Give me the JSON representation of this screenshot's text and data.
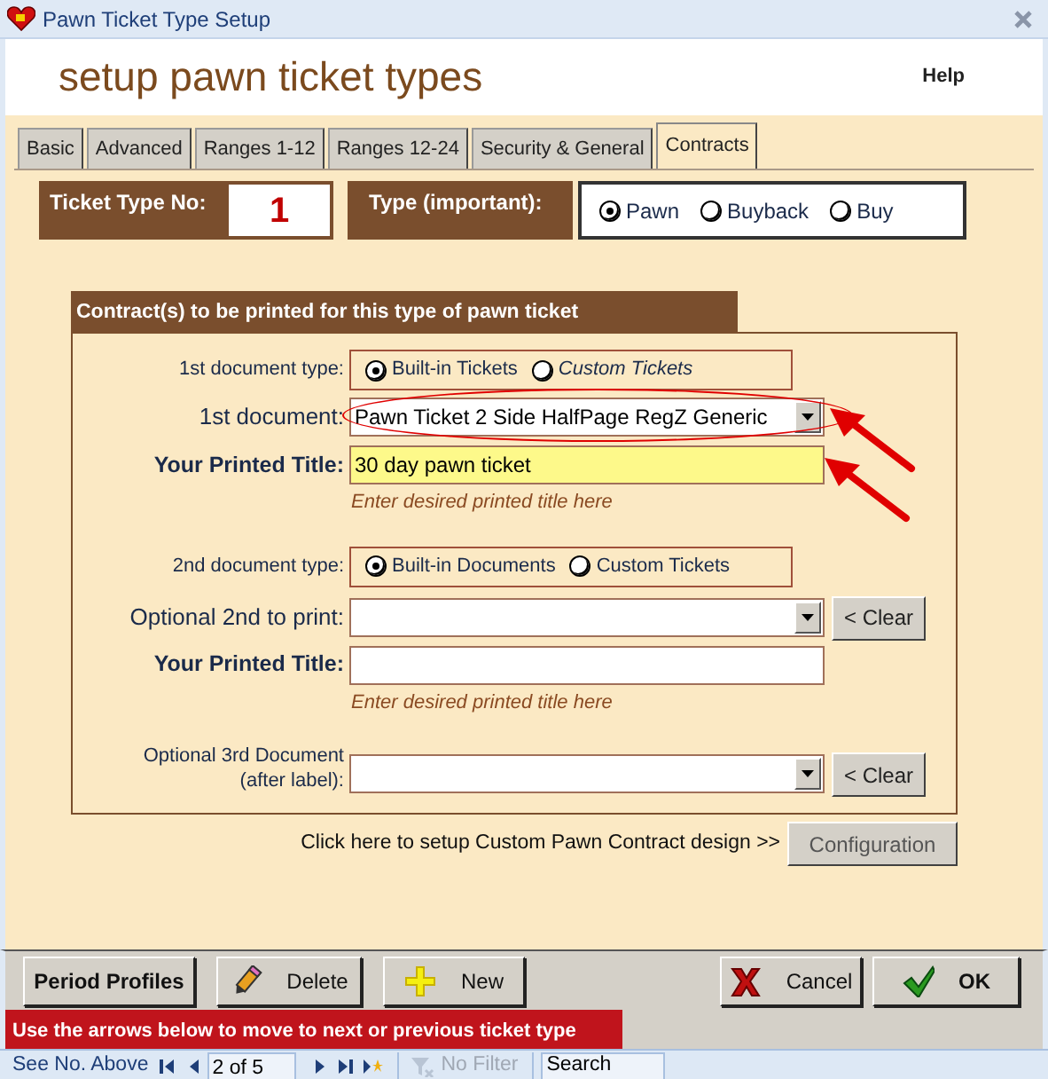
{
  "window": {
    "title": "Pawn Ticket Type Setup"
  },
  "header": {
    "title": "setup pawn ticket types",
    "help_link": "Help"
  },
  "tabs": [
    {
      "label": "Basic",
      "selected": false
    },
    {
      "label": "Advanced",
      "selected": false
    },
    {
      "label": "Ranges 1-12",
      "selected": false
    },
    {
      "label": "Ranges 12-24",
      "selected": false
    },
    {
      "label": "Security & General",
      "selected": false
    },
    {
      "label": "Contracts",
      "selected": true
    }
  ],
  "ticket_type": {
    "label": "Ticket Type No:",
    "value": "1"
  },
  "type": {
    "label": "Type (important):",
    "options": [
      {
        "label": "Pawn",
        "selected": true
      },
      {
        "label": "Buyback",
        "selected": false
      },
      {
        "label": "Buy",
        "selected": false
      }
    ]
  },
  "contracts": {
    "title": "Contract(s) to be printed for this type of pawn ticket",
    "first": {
      "type_label": "1st document type:",
      "type_options": [
        {
          "label": "Built-in Tickets",
          "selected": true,
          "italic": false
        },
        {
          "label": "Custom Tickets",
          "selected": false,
          "italic": true
        }
      ],
      "document_label": "1st document:",
      "document_value": "Pawn Ticket 2 Side HalfPage RegZ Generic",
      "document_circled": true,
      "document_arrow": true,
      "title_label": "Your Printed Title:",
      "title_value": "30 day pawn ticket",
      "title_arrow": true,
      "hint": "Enter desired printed title here"
    },
    "second": {
      "type_label": "2nd document type:",
      "type_options": [
        {
          "label": "Built-in Documents",
          "selected": true,
          "italic": false
        },
        {
          "label": "Custom Tickets",
          "selected": false,
          "italic": false
        }
      ],
      "document_label": "Optional 2nd to print:",
      "clear": "< Clear",
      "title_label": "Your Printed Title:",
      "hint": "Enter desired printed title here"
    },
    "third": {
      "label": "Optional 3rd Document (after label):",
      "clear": "< Clear"
    }
  },
  "config": {
    "text": "Click here to setup Custom Pawn Contract design >>",
    "button": "Configuration"
  },
  "buttons": [
    {
      "label": "Period Profiles",
      "kind": "plain"
    },
    {
      "label": "Delete",
      "kind": "delete"
    },
    {
      "label": "New",
      "kind": "new"
    },
    {
      "label": "Cancel",
      "kind": "cancel"
    },
    {
      "label": "OK",
      "kind": "ok"
    }
  ],
  "notice": "Use the arrows below to move to next or previous ticket type",
  "navigator": {
    "label": "See No. Above",
    "record": "2 of 5",
    "filter": "No Filter",
    "search_placeholder": "Search"
  }
}
